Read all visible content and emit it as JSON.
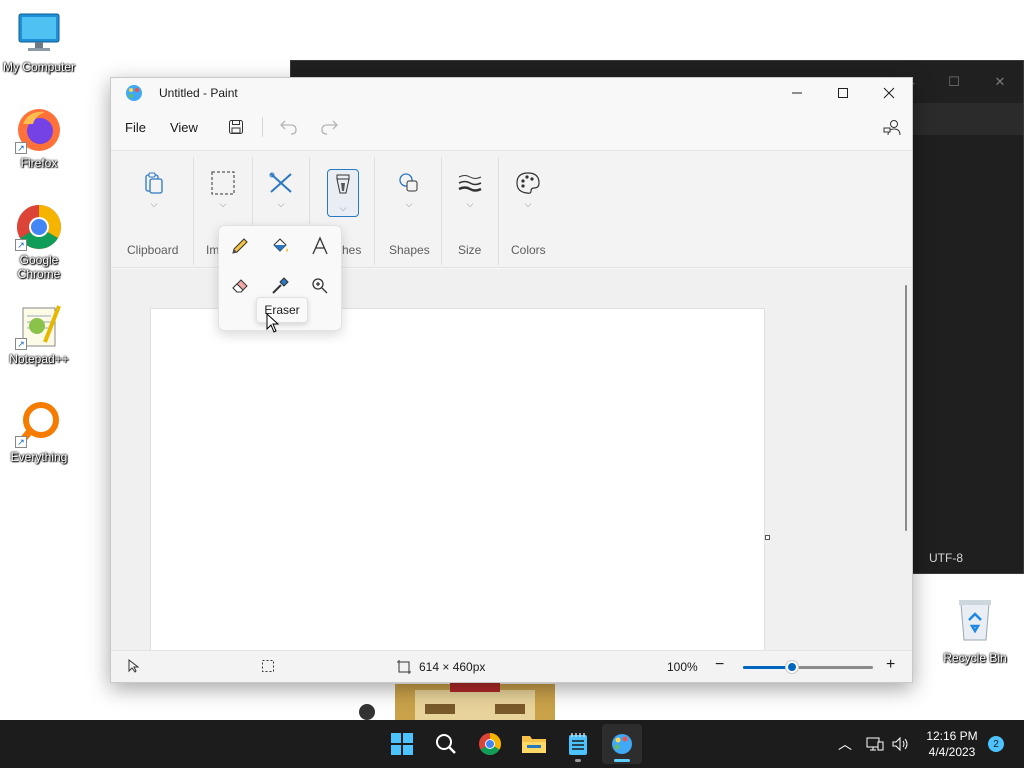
{
  "desktop": {
    "icons": [
      {
        "label": "My Computer",
        "icon": "computer-icon"
      },
      {
        "label": "Firefox",
        "icon": "firefox-icon"
      },
      {
        "label": "Google Chrome",
        "icon": "chrome-icon"
      },
      {
        "label": "Notepad++",
        "icon": "notepadpp-icon"
      },
      {
        "label": "Everything",
        "icon": "everything-icon"
      }
    ],
    "recycle_bin": "Recycle Bin"
  },
  "background_window": {
    "encoding": "UTF-8"
  },
  "paint": {
    "title": "Untitled - Paint",
    "menu": {
      "file": "File",
      "view": "View"
    },
    "ribbon": {
      "clipboard": "Clipboard",
      "image": "Im",
      "brushes": "ches",
      "shapes": "Shapes",
      "size": "Size",
      "colors": "Colors"
    },
    "tools_flyout": {
      "tools": [
        "pencil",
        "fill",
        "text",
        "eraser",
        "color-picker",
        "magnifier"
      ],
      "tooltip": "Eraser"
    },
    "status": {
      "canvas_size": "614 × 460px",
      "zoom": "100%",
      "zoom_fraction": 0.38
    }
  },
  "taskbar": {
    "apps": [
      "start",
      "search",
      "chrome",
      "file-explorer",
      "notepad",
      "paint"
    ],
    "time": "12:16 PM",
    "date": "4/4/2023",
    "notifications": "2"
  }
}
